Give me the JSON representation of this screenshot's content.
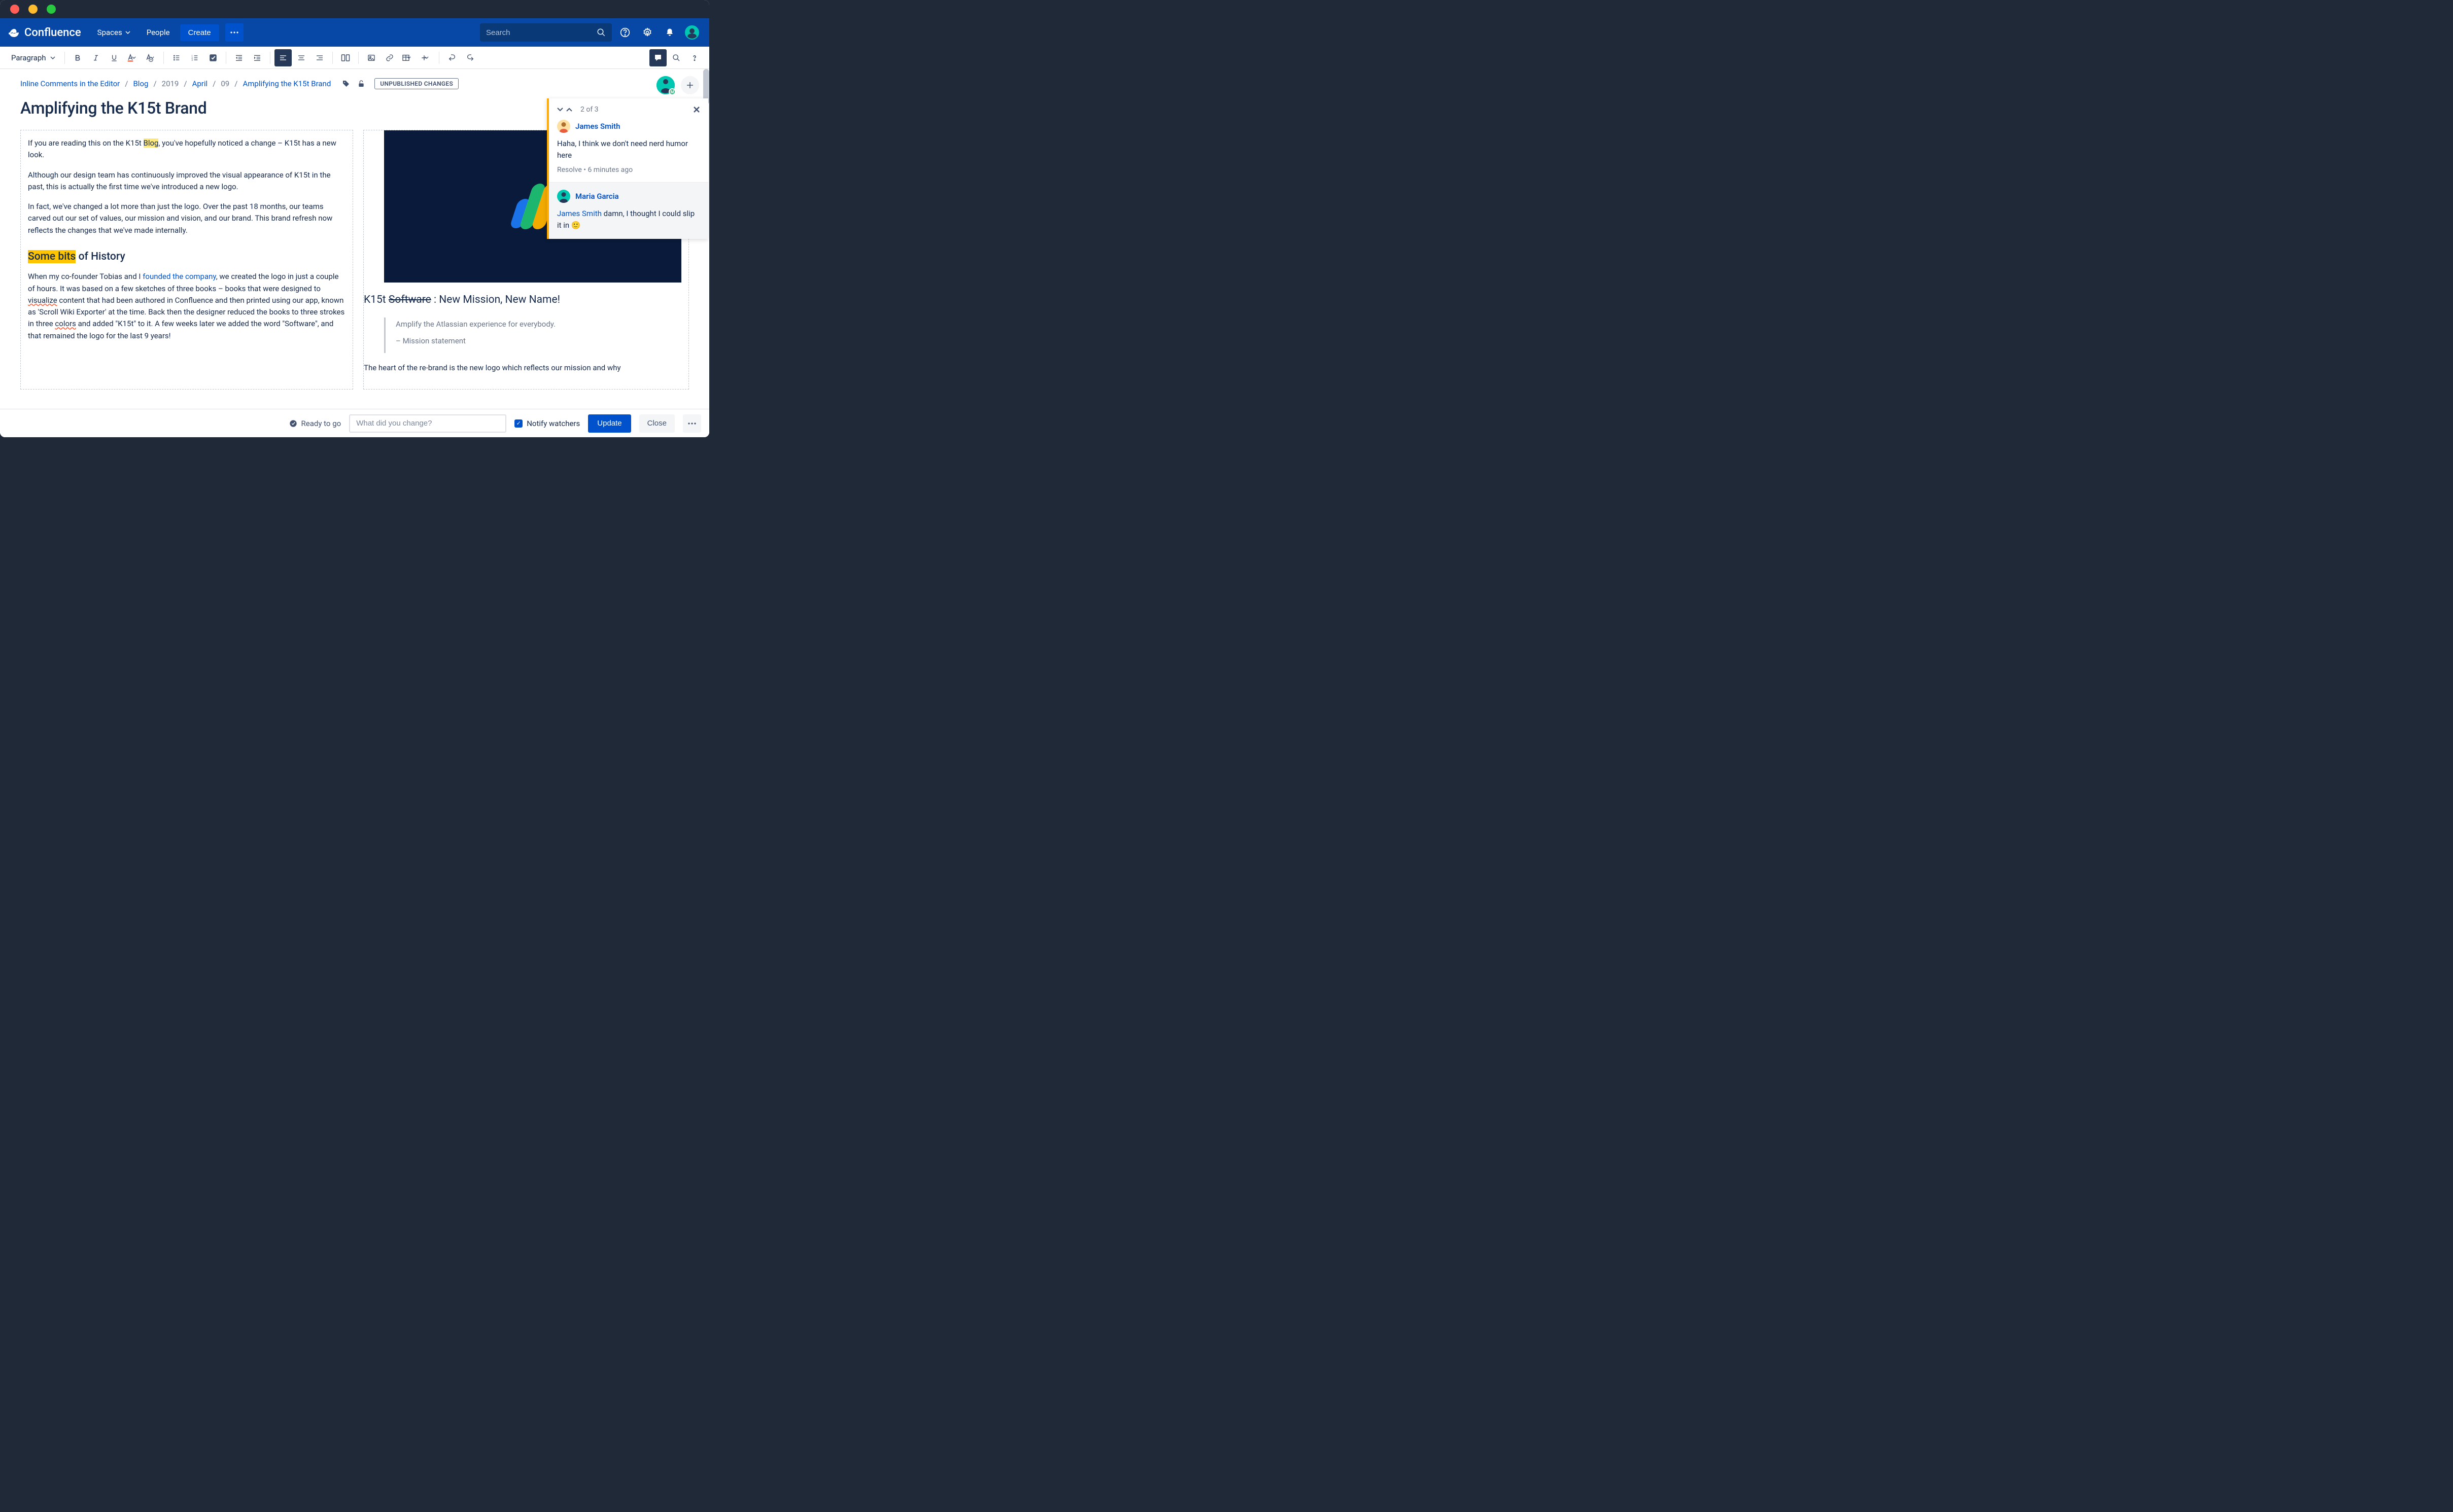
{
  "app": {
    "name": "Confluence"
  },
  "nav": {
    "spaces": "Spaces",
    "people": "People",
    "create": "Create",
    "search_placeholder": "Search"
  },
  "toolbar": {
    "style": "Paragraph"
  },
  "breadcrumbs": {
    "items": [
      "Inline Comments in the Editor",
      "Blog",
      "2019",
      "April",
      "09",
      "Amplifying the K15t Brand"
    ],
    "badge": "UNPUBLISHED CHANGES"
  },
  "page": {
    "title": "Amplifying the K15t Brand"
  },
  "col1": {
    "p1a": "If you are reading this on the K15t ",
    "p1_hl": "Blog",
    "p1b": ", you've hopefully noticed a change – K15t has a new look.",
    "p2": "Although our design team has continuously improved the visual appearance of K15t in the past, this is actually the first time we've introduced a new logo.",
    "p3": "In fact, we've changed a lot more than just the logo. Over the past 18 months, our teams carved out our set of values, our mission and vision, and our brand. This brand refresh now reflects the changes that we've made internally.",
    "h2_hl": "Some bits",
    "h2_rest": " of History",
    "p4a": "When my co-founder Tobias and I ",
    "p4_link": "founded the company",
    "p4b": ", we created the logo in just a couple of hours. It was based on a few sketches of three books – books that were designed to ",
    "p4_sp1": "visualize",
    "p4c": " content that had been authored in Confluence and then printed using our app, known as 'Scroll Wiki Exporter' at the time. Back then the designer reduced the books to three strokes in three ",
    "p4_sp2": "colors",
    "p4d": " and added \"K15t\" to it. A few weeks later we added the word \"Software\", and that remained the logo for the last 9 years!"
  },
  "col2": {
    "title_a": "K15t ",
    "title_strike": "Software",
    "title_b": " : New Mission, New Name!",
    "quote1": "Amplify the Atlassian experience for everybody.",
    "quote2": "– Mission statement",
    "p1": "The heart of the re-brand is the new logo which reflects our mission and why"
  },
  "comments": {
    "counter": "2 of 3",
    "c1": {
      "author": "James Smith",
      "body": "Haha, I think we don't need nerd humor here",
      "resolve": "Resolve",
      "time": "6 minutes ago"
    },
    "c2": {
      "author": "Maria Garcia",
      "mention": "James Smith",
      "body": " damn, I thought I could slip it in 🙂"
    }
  },
  "footer": {
    "status": "Ready to go",
    "change_placeholder": "What did you change?",
    "notify": "Notify watchers",
    "update": "Update",
    "close": "Close"
  }
}
